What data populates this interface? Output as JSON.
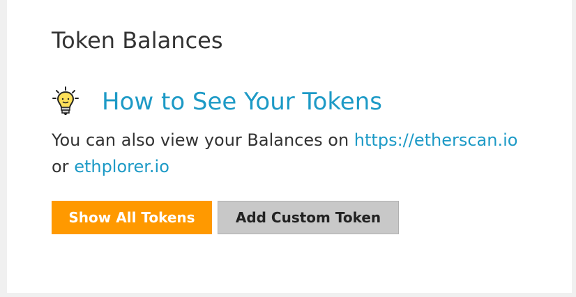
{
  "panel": {
    "title": "Token Balances",
    "howto_link": "How to See Your Tokens",
    "description_prefix": "You can also view your Balances on ",
    "etherscan_link": "https://etherscan.io",
    "description_or": "or ",
    "ethplorer_link": "ethplorer.io",
    "bulb_icon": "lightbulb-icon"
  },
  "buttons": {
    "show_all_label": "Show All Tokens",
    "add_custom_label": "Add Custom Token"
  },
  "colors": {
    "link": "#1d9ac6",
    "primary": "#ff9900",
    "secondary": "#c8c8c8"
  }
}
